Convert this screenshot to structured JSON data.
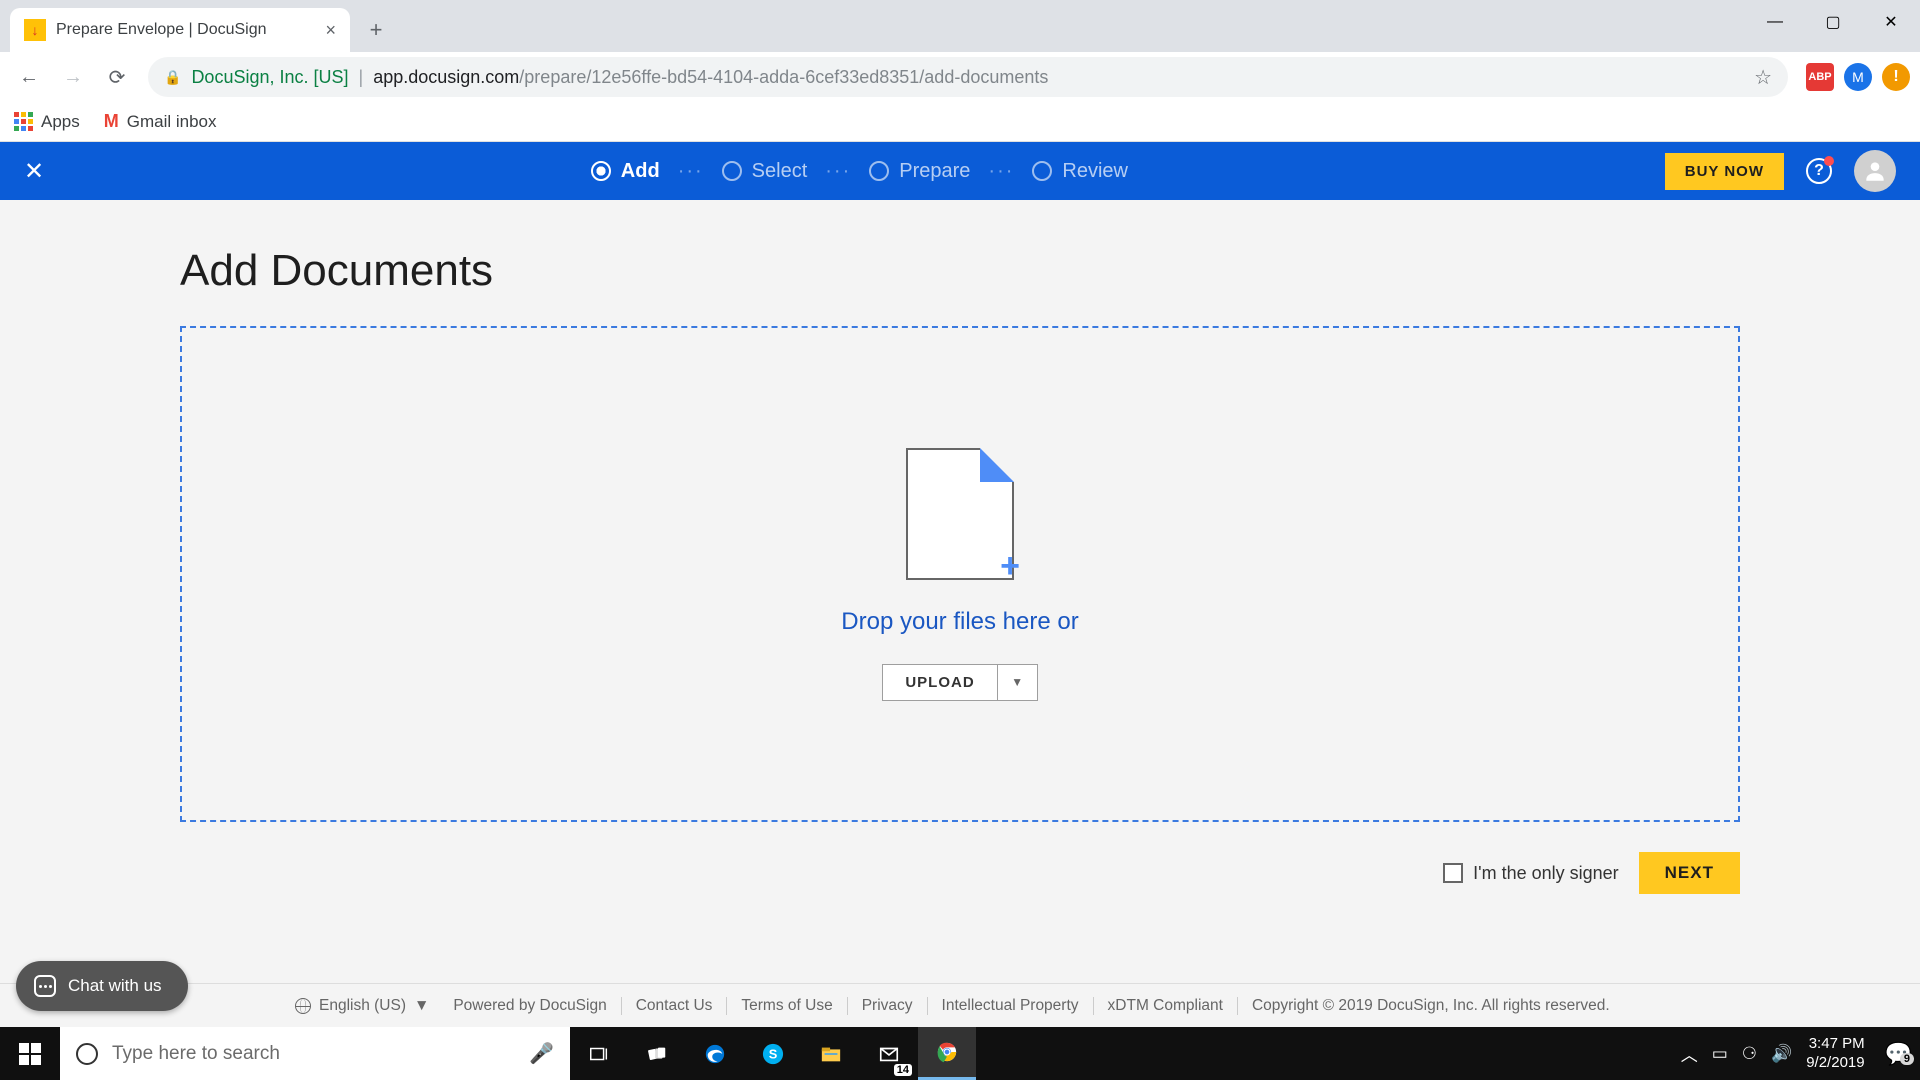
{
  "browser": {
    "tab_title": "Prepare Envelope | DocuSign",
    "url_org": "DocuSign, Inc. [US]",
    "url_host": "app.docusign.com",
    "url_path": "/prepare/12e56ffe-bd54-4104-adda-6cef33ed8351/add-documents",
    "profile_letter": "M",
    "abp_label": "ABP",
    "bookmarks": {
      "apps": "Apps",
      "gmail": "Gmail inbox"
    }
  },
  "ds": {
    "steps": [
      "Add",
      "Select",
      "Prepare",
      "Review"
    ],
    "active_step_index": 0,
    "buy_now": "BUY NOW",
    "page_title": "Add Documents",
    "drop_text": "Drop your files here or",
    "upload_label": "UPLOAD",
    "only_signer_label": "I'm the only signer",
    "next_label": "NEXT",
    "chat_label": "Chat with us",
    "footer": {
      "language": "English (US)",
      "links": [
        "Powered by DocuSign",
        "Contact Us",
        "Terms of Use",
        "Privacy",
        "Intellectual Property",
        "xDTM Compliant"
      ],
      "copyright": "Copyright © 2019 DocuSign, Inc. All rights reserved."
    }
  },
  "taskbar": {
    "search_placeholder": "Type here to search",
    "mail_count": "14",
    "notif_count": "9",
    "time": "3:47 PM",
    "date": "9/2/2019"
  }
}
